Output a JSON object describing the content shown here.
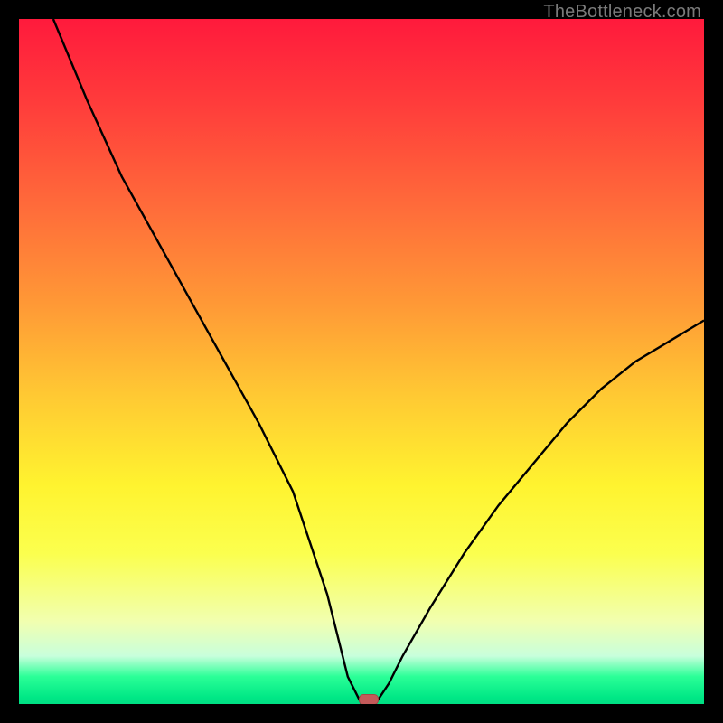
{
  "watermark": "TheBottleneck.com",
  "colors": {
    "curve_stroke": "#000000",
    "marker_fill": "#c45a5a",
    "marker_border": "#a84646"
  },
  "chart_data": {
    "type": "line",
    "title": "",
    "xlabel": "",
    "ylabel": "",
    "xlim": [
      0,
      100
    ],
    "ylim": [
      0,
      100
    ],
    "grid": false,
    "legend_position": "none",
    "series": [
      {
        "name": "bottleneck-curve",
        "x": [
          5,
          10,
          15,
          20,
          25,
          30,
          35,
          40,
          45,
          48,
          50,
          51,
          52,
          54,
          56,
          60,
          65,
          70,
          75,
          80,
          85,
          90,
          95,
          100
        ],
        "values": [
          100,
          88,
          77,
          68,
          59,
          50,
          41,
          31,
          16,
          4,
          0,
          0,
          0,
          3,
          7,
          14,
          22,
          29,
          35,
          41,
          46,
          50,
          53,
          56
        ]
      }
    ],
    "marker": {
      "x": 51,
      "y": 0
    }
  }
}
